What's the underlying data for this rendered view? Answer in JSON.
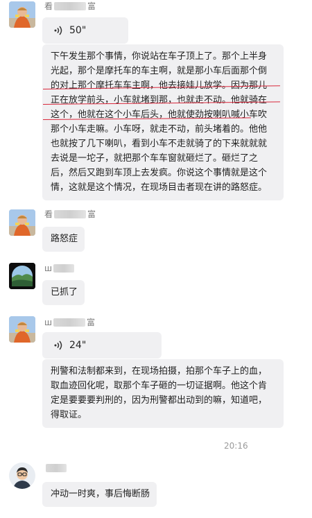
{
  "conversation": {
    "timestamp": "20:16",
    "messages": [
      {
        "sender_partial": "看",
        "sender_suffix": "富",
        "type": "voice",
        "duration": "50\""
      },
      {
        "type": "text",
        "text": "下午发生那个事情，你说站在车子顶上了。那个上半身光起，那个是摩托车的车主啊，就是那小车后面那个倒的对上那个摩托车车主啊，他去接娃儿放学。因为那儿正在放学前头，小车就堵到那，也就走不动。他就骑在这个，他就在这个小车后头，他就使劲按喇叭喊小车吹那个小车走嘛。小车呀，就走不动，前头堵着的。他他也就按了几下喇叭，看到小车不走就骑了的下来就就就去说是一坨子，就把那个车车窗就砸烂了。砸烂了之后，然后又跑到车顶上去发疯。你说这个事情就是这个情，这就是这个情况，在现场目击者现在讲的路怒症。"
      },
      {
        "sender_partial": "看",
        "sender_suffix": "富",
        "type": "text",
        "text": "路怒症"
      },
      {
        "sender_partial": "ш",
        "type": "text",
        "text": "已抓了"
      },
      {
        "sender_partial": "ш",
        "sender_suffix": "富",
        "type": "voice",
        "duration": "24\""
      },
      {
        "type": "text",
        "text": "刑警和法制都来到，在现场拍摄，拍那个车子上的血，取血迹回化呢，取那个车子砸的一切证据啊。他这个肯定是要要要判刑的，因为刑警都出动到的嘛，知道吧，得取证。"
      },
      {
        "sender_partial": "",
        "type": "text",
        "text": "冲动一时爽，事后悔断肠"
      }
    ]
  },
  "icons": {
    "voice": "voice-wave-icon",
    "avatar_1": "monk-avatar",
    "avatar_2": "landscape-avatar",
    "avatar_3": "cartoon-man-avatar"
  },
  "colors": {
    "bubble": "#f0f0f2",
    "underline": "#d9263a",
    "timestamp": "#9a9a9a"
  }
}
